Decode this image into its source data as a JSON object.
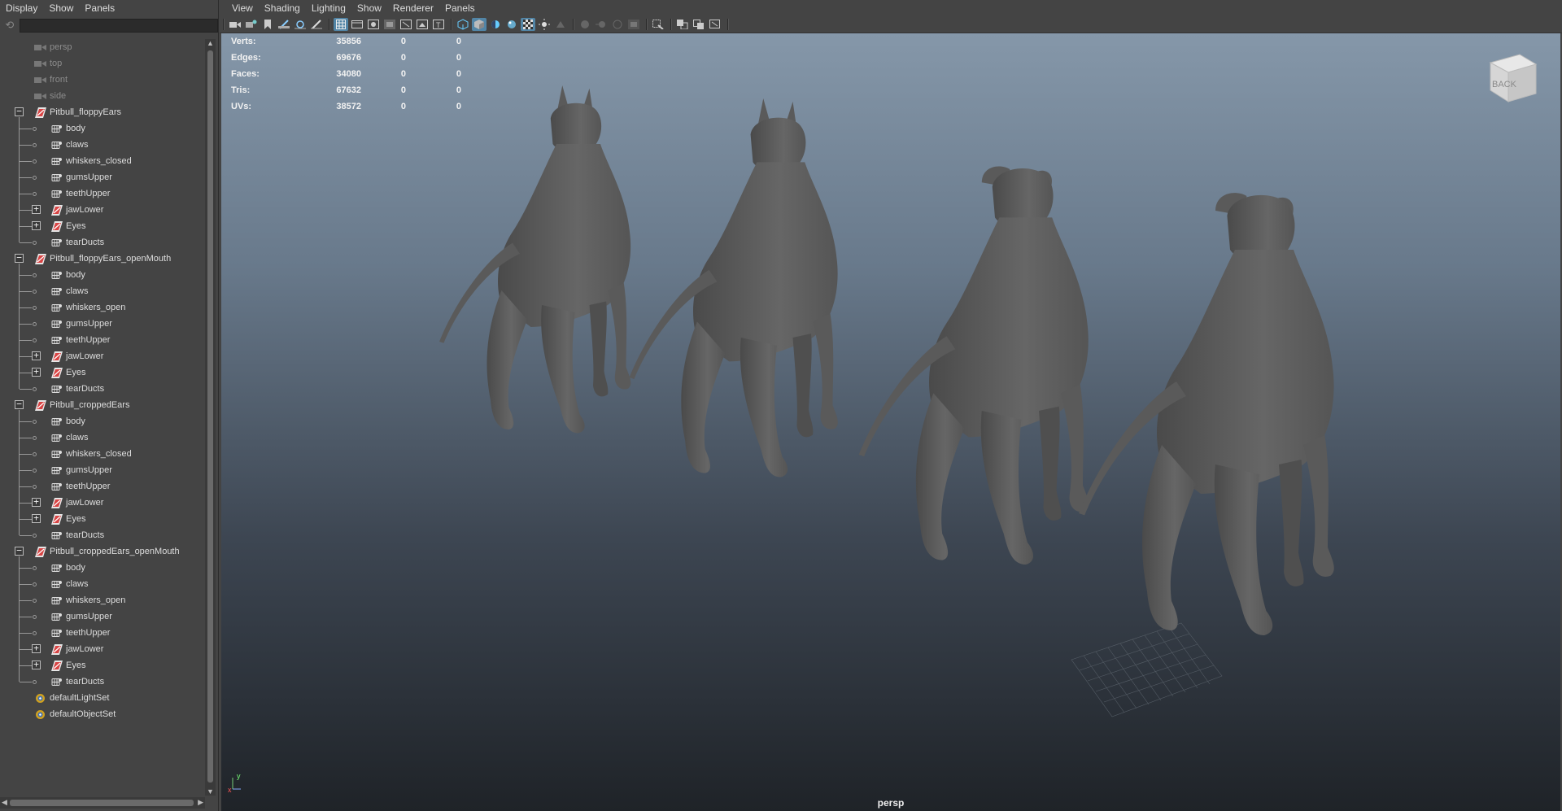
{
  "outliner": {
    "menu": [
      "Display",
      "Show",
      "Panels"
    ],
    "filter_placeholder": "",
    "cameras": [
      "persp",
      "top",
      "front",
      "side"
    ],
    "groups": [
      {
        "name": "Pitbull_floppyEars",
        "children": [
          {
            "name": "body",
            "kind": "mesh"
          },
          {
            "name": "claws",
            "kind": "mesh"
          },
          {
            "name": "whiskers_closed",
            "kind": "mesh"
          },
          {
            "name": "gumsUpper",
            "kind": "mesh"
          },
          {
            "name": "teethUpper",
            "kind": "mesh"
          },
          {
            "name": "jawLower",
            "kind": "group"
          },
          {
            "name": "Eyes",
            "kind": "group"
          },
          {
            "name": "tearDucts",
            "kind": "mesh"
          }
        ]
      },
      {
        "name": "Pitbull_floppyEars_openMouth",
        "children": [
          {
            "name": "body",
            "kind": "mesh"
          },
          {
            "name": "claws",
            "kind": "mesh"
          },
          {
            "name": "whiskers_open",
            "kind": "mesh"
          },
          {
            "name": "gumsUpper",
            "kind": "mesh"
          },
          {
            "name": "teethUpper",
            "kind": "mesh"
          },
          {
            "name": "jawLower",
            "kind": "group"
          },
          {
            "name": "Eyes",
            "kind": "group"
          },
          {
            "name": "tearDucts",
            "kind": "mesh"
          }
        ]
      },
      {
        "name": "Pitbull_croppedEars",
        "children": [
          {
            "name": "body",
            "kind": "mesh"
          },
          {
            "name": "claws",
            "kind": "mesh"
          },
          {
            "name": "whiskers_closed",
            "kind": "mesh"
          },
          {
            "name": "gumsUpper",
            "kind": "mesh"
          },
          {
            "name": "teethUpper",
            "kind": "mesh"
          },
          {
            "name": "jawLower",
            "kind": "group"
          },
          {
            "name": "Eyes",
            "kind": "group"
          },
          {
            "name": "tearDucts",
            "kind": "mesh"
          }
        ]
      },
      {
        "name": "Pitbull_croppedEars_openMouth",
        "children": [
          {
            "name": "body",
            "kind": "mesh"
          },
          {
            "name": "claws",
            "kind": "mesh"
          },
          {
            "name": "whiskers_open",
            "kind": "mesh"
          },
          {
            "name": "gumsUpper",
            "kind": "mesh"
          },
          {
            "name": "teethUpper",
            "kind": "mesh"
          },
          {
            "name": "jawLower",
            "kind": "group"
          },
          {
            "name": "Eyes",
            "kind": "group"
          },
          {
            "name": "tearDucts",
            "kind": "mesh"
          }
        ]
      }
    ],
    "sets": [
      "defaultLightSet",
      "defaultObjectSet"
    ]
  },
  "panel": {
    "menu": [
      "View",
      "Shading",
      "Lighting",
      "Show",
      "Renderer",
      "Panels"
    ]
  },
  "hud": {
    "rows": [
      {
        "label": "Verts:",
        "value": "35856",
        "sel": "0",
        "comp": "0"
      },
      {
        "label": "Edges:",
        "value": "69676",
        "sel": "0",
        "comp": "0"
      },
      {
        "label": "Faces:",
        "value": "34080",
        "sel": "0",
        "comp": "0"
      },
      {
        "label": "Tris:",
        "value": "67632",
        "sel": "0",
        "comp": "0"
      },
      {
        "label": "UVs:",
        "value": "38572",
        "sel": "0",
        "comp": "0"
      }
    ]
  },
  "viewport": {
    "camera_name": "persp",
    "viewcube_label": "BACK",
    "axis_y": "y",
    "axis_x": "x"
  },
  "colors": {
    "accent": "#5285a6",
    "dog": "#5a5a5a",
    "group_icon": "#d84444"
  }
}
